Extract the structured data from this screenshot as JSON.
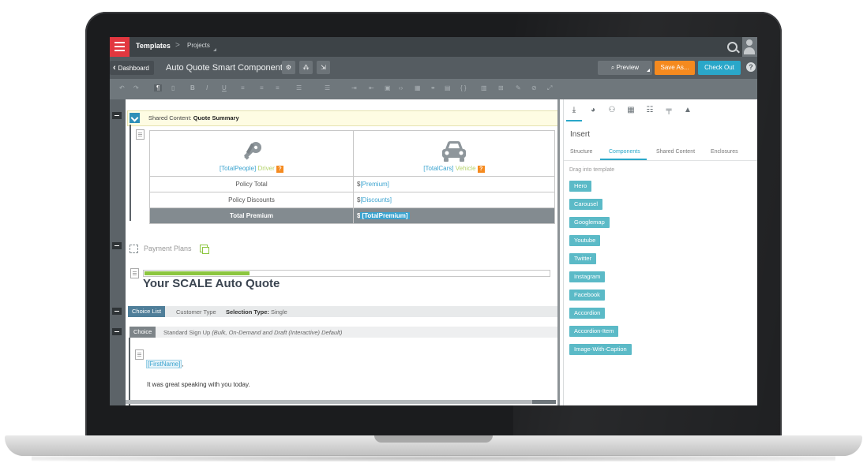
{
  "nav": {
    "templates": "Templates",
    "separator": ">",
    "projects": "Projects"
  },
  "toolbar": {
    "dashboard": "Dashboard",
    "title": "Auto Quote Smart Component",
    "preview": "Preview",
    "save_as": "Save As...",
    "check_out": "Check Out",
    "help": "?"
  },
  "format_icons": [
    "undo-icon",
    "redo-icon",
    "pilcrow-icon",
    "clipboard-icon",
    "bold-icon",
    "italic-icon",
    "underline-icon",
    "align-left-icon",
    "align-center-icon",
    "align-right-icon",
    "list-icon",
    "list-numbered-icon",
    "indent-icon",
    "outdent-icon",
    "image-icon",
    "code-icon",
    "table-icon",
    "link-icon",
    "unlink-icon",
    "embed-icon",
    "source-icon",
    "grid-icon",
    "spell-icon",
    "clear-icon",
    "fullscreen-icon"
  ],
  "editor": {
    "shared_prefix": "Shared Content: ",
    "shared_name": "Quote Summary",
    "people_token": "[TotalPeople]",
    "driver_word": "Driver",
    "cars_token": "[TotalCars]",
    "vehicle_word": "Vehicle",
    "badge": "?",
    "rows": [
      {
        "label": "Policy Total",
        "currency": "$",
        "token": "[Premium]"
      },
      {
        "label": "Policy Discounts",
        "currency": "$",
        "token": "[Discounts]"
      }
    ],
    "total_label": "Total Premium",
    "total_currency": "$",
    "total_token": "[TotalPremium]",
    "payment_plans": "Payment Plans",
    "progress": 0.26,
    "quote_heading": "Your SCALE Auto Quote",
    "choice_list": "Choice List",
    "customer_type": "Customer Type",
    "selection_type_label": "Selection Type:",
    "selection_type_value": "Single",
    "choice": "Choice",
    "std_signup": "Standard Sign Up",
    "std_signup_detail": "(Bulk, On-Demand and Draft (Interactive) Default)",
    "firstname_token": "[FirstName]",
    "firstname_comma": ",",
    "greeting": "It was great speaking with you today."
  },
  "panel": {
    "insert": "Insert",
    "subtabs": [
      "Structure",
      "Components",
      "Shared Content",
      "Enclosures"
    ],
    "drag_hint": "Drag into template",
    "components": [
      "Hero",
      "Carousel",
      "Googlemap",
      "Youtube",
      "Twitter",
      "Instagram",
      "Facebook",
      "Accordion",
      "Accordion-Item",
      "Image-With-Caption"
    ]
  },
  "colors": {
    "orange": "#f58a1f",
    "blue": "#2aa7c9",
    "green": "#8cc63f",
    "red": "#e2373f"
  }
}
